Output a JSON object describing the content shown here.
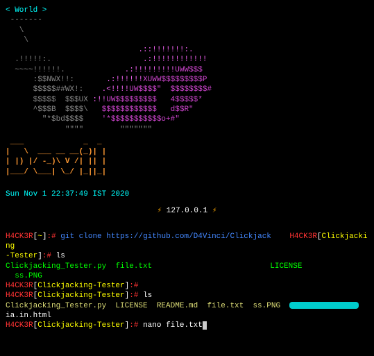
{
  "header": {
    "world": "< World >"
  },
  "ascii": {
    "line1": " -------",
    "line2": "   \\",
    "line3": "    \\",
    "line4a": "                             .::!!!!!!!:.",
    "line5a": "  .!!!!!:.",
    "line5b": "                    .:!!!!!!!!!!!!",
    "line6a": "  ~~~~!!!!!!.",
    "line6b": "             .:!!!!!!!!!",
    "line6c": "UWW$$$",
    "line7a": "      :$$NWX!!:",
    "line7b": "       .:!!!!!!",
    "line7c": "XUWW$$$$$$$$$P",
    "line8a": "      $$$$$##WX!:",
    "line8b": "    .<!!!!",
    "line8c": "UW$$$$\"  $$$$$$$$#",
    "line9a": "      $$$$$  $$$UX",
    "line9b": " :!!",
    "line9c": "UW$$$$$$$$$   4$$$$$*",
    "line10a": "      ^$$$B  $$$$\\",
    "line10b": "   $$$$$$$$$$$$   d$$R\"",
    "line11a": "        \"*$bd$$$$",
    "line11b": "    '*$$$$$$$$$$$o+#\"",
    "line12": "             \"\"\"\"        \"\"\"\"\"\"\""
  },
  "devil": {
    "l1": " ___             _  _ ",
    "l2": "|   \\  ___ __ __(_)| |",
    "l3": "| |) |/ -_)\\ V /| || |",
    "l4": "|___/ \\___| \\_/ |_||_|"
  },
  "datetime": "Sun Nov  1 22:37:49 IST 2020",
  "ip": "127.0.0.1",
  "prompt": {
    "user": "H4CK3R",
    "tilde_folder": "~",
    "cj_folder": "Clickjacking-Tester",
    "cj_short": "Clickjacking",
    "cj_tail": "-Tester",
    "sep": ":#"
  },
  "commands": {
    "git_clone": "git clone https://github.com/D4Vinci/Clickjack",
    "ls": "ls",
    "ls_out1a": "Clickjacking_Tester.py",
    "ls_out1b": "file.txt",
    "ls_out1_right": "LICENSE",
    "ss_png": "ss.PNG",
    "ls2_items": "Clickjacking_Tester.py  LICENSE  README.md  file.txt  ss.PNG",
    "iahtml": "ia.in.html",
    "nano": "nano file.txt"
  }
}
